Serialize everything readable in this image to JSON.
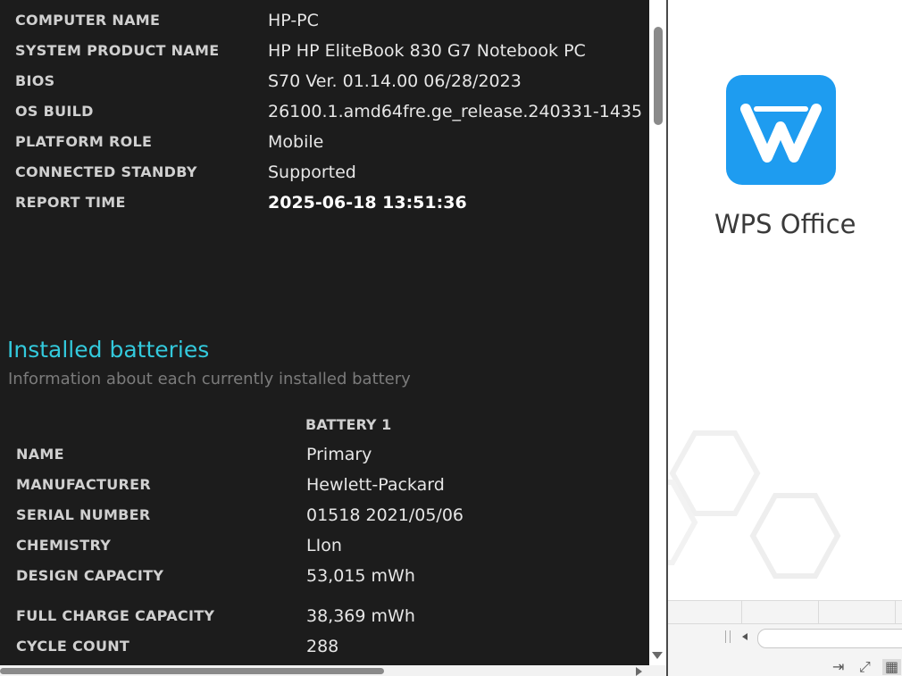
{
  "report": {
    "system_info": [
      {
        "label": "COMPUTER NAME",
        "value": "HP-PC"
      },
      {
        "label": "SYSTEM PRODUCT NAME",
        "value": "HP HP EliteBook 830 G7 Notebook PC"
      },
      {
        "label": "BIOS",
        "value": "S70 Ver. 01.14.00 06/28/2023"
      },
      {
        "label": "OS BUILD",
        "value": "26100.1.amd64fre.ge_release.240331-1435"
      },
      {
        "label": "PLATFORM ROLE",
        "value": "Mobile"
      },
      {
        "label": "CONNECTED STANDBY",
        "value": "Supported"
      },
      {
        "label": "REPORT TIME",
        "value": "2025-06-18  13:51:36"
      }
    ],
    "batteries": {
      "title": "Installed batteries",
      "subtitle": "Information about each currently installed battery",
      "column_header": "BATTERY 1",
      "rows": [
        {
          "label": "NAME",
          "value": "Primary"
        },
        {
          "label": "MANUFACTURER",
          "value": "Hewlett-Packard"
        },
        {
          "label": "SERIAL NUMBER",
          "value": "01518 2021/05/06"
        },
        {
          "label": "CHEMISTRY",
          "value": "LIon"
        },
        {
          "label": "DESIGN CAPACITY",
          "value": "53,015 mWh"
        },
        {
          "label": "FULL CHARGE CAPACITY",
          "value": "38,369 mWh"
        },
        {
          "label": "CYCLE COUNT",
          "value": "288"
        }
      ]
    }
  },
  "wps": {
    "app_name": "WPS Office",
    "logo_color": "#1e9cf0"
  },
  "status_bar": {
    "icons": [
      "export-icon",
      "fullscreen-icon",
      "grid-view-icon"
    ]
  }
}
